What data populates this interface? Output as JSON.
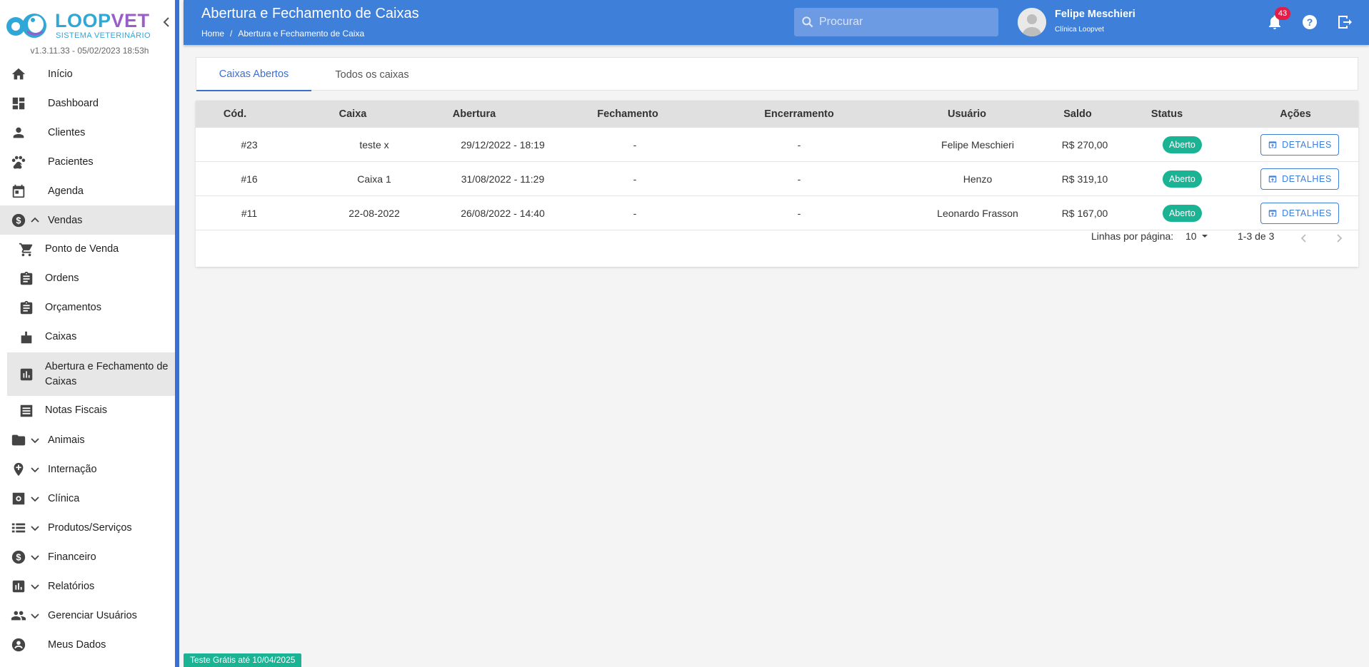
{
  "brand": {
    "name_part1": "LOOP",
    "name_part2": "VET",
    "subtitle": "SISTEMA VETERINÁRIO",
    "version": "v1.3.11.33 - 05/02/2023 18:53h",
    "colors": {
      "primary": "#3d7fd9",
      "accent_blue": "#2fa7d7",
      "accent_purple": "#9a5ec9",
      "status_green": "#1ab394",
      "badge_red": "#e11d48"
    }
  },
  "sidebar": {
    "items": [
      {
        "label": "Início",
        "icon": "home-icon"
      },
      {
        "label": "Dashboard",
        "icon": "dashboard-icon"
      },
      {
        "label": "Clientes",
        "icon": "person-icon"
      },
      {
        "label": "Pacientes",
        "icon": "paw-icon"
      },
      {
        "label": "Agenda",
        "icon": "calendar-icon"
      },
      {
        "label": "Vendas",
        "icon": "dollar-icon",
        "expanded": true
      },
      {
        "label": "Animais",
        "icon": "folder-icon"
      },
      {
        "label": "Internação",
        "icon": "hospital-icon"
      },
      {
        "label": "Clínica",
        "icon": "gear-icon"
      },
      {
        "label": "Produtos/Serviços",
        "icon": "list-icon"
      },
      {
        "label": "Financeiro",
        "icon": "dollar-icon"
      },
      {
        "label": "Relatórios",
        "icon": "chart-icon"
      },
      {
        "label": "Gerenciar Usuários",
        "icon": "group-icon"
      },
      {
        "label": "Meus Dados",
        "icon": "account-icon"
      }
    ],
    "vendas_sub": [
      {
        "label": "Ponto de Venda",
        "icon": "cart-icon"
      },
      {
        "label": "Ordens",
        "icon": "clipboard-icon"
      },
      {
        "label": "Orçamentos",
        "icon": "clipboard-icon"
      },
      {
        "label": "Caixas",
        "icon": "register-icon"
      },
      {
        "label": "Abertura e Fechamento de Caixas",
        "icon": "report-icon",
        "active": true
      },
      {
        "label": "Notas Fiscais",
        "icon": "document-icon"
      }
    ]
  },
  "header": {
    "title": "Abertura e Fechamento de Caixas",
    "breadcrumb": {
      "home": "Home",
      "separator": "/",
      "current": "Abertura e Fechamento de Caixa"
    },
    "search_placeholder": "Procurar",
    "user": {
      "name": "Felipe Meschieri",
      "clinic": "Clínica Loopvet"
    },
    "notifications": "43"
  },
  "tabs": [
    {
      "label": "Caixas Abertos",
      "active": true
    },
    {
      "label": "Todos os caixas",
      "active": false
    }
  ],
  "table": {
    "columns": [
      "Cód.",
      "Caixa",
      "Abertura",
      "Fechamento",
      "Encerramento",
      "Usuário",
      "Saldo",
      "Status",
      "Ações"
    ],
    "rows": [
      {
        "cod": "#23",
        "caixa": "teste x",
        "abertura": "29/12/2022 - 18:19",
        "fechamento": "-",
        "encerramento": "-",
        "usuario": "Felipe Meschieri",
        "saldo": "R$ 270,00",
        "status": "Aberto",
        "acao": "DETALHES"
      },
      {
        "cod": "#16",
        "caixa": "Caixa 1",
        "abertura": "31/08/2022 - 11:29",
        "fechamento": "-",
        "encerramento": "-",
        "usuario": "Henzo",
        "saldo": "R$ 319,10",
        "status": "Aberto",
        "acao": "DETALHES"
      },
      {
        "cod": "#11",
        "caixa": "22-08-2022",
        "abertura": "26/08/2022 - 14:40",
        "fechamento": "-",
        "encerramento": "-",
        "usuario": "Leonardo Frasson",
        "saldo": "R$ 167,00",
        "status": "Aberto",
        "acao": "DETALHES"
      }
    ],
    "pagination": {
      "rows_per_page_label": "Linhas por página:",
      "rows_per_page": "10",
      "range": "1-3 de 3"
    }
  },
  "trial_banner": "Teste Grátis até 10/04/2025"
}
